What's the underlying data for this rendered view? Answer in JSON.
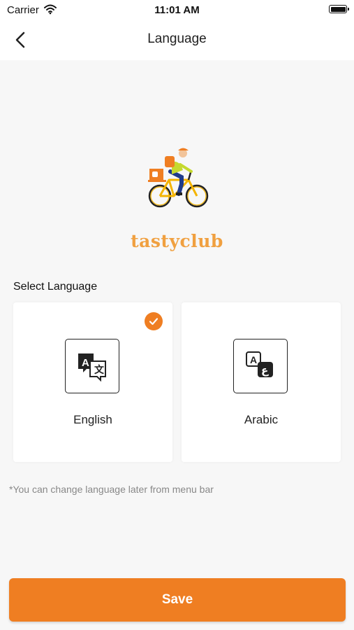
{
  "status_bar": {
    "carrier": "Carrier",
    "time": "11:01 AM"
  },
  "header": {
    "title": "Language"
  },
  "brand": {
    "name": "tastyclub"
  },
  "section": {
    "label": "Select Language"
  },
  "languages": [
    {
      "label": "English",
      "selected": true,
      "icon": "translate-icon"
    },
    {
      "label": "Arabic",
      "selected": false,
      "icon": "arabic-letters-icon"
    }
  ],
  "hint": "*You can change language later from menu bar",
  "save_label": "Save",
  "colors": {
    "accent": "#ef7e22",
    "brand_text": "#f0a040",
    "background": "#f7f7f7"
  }
}
